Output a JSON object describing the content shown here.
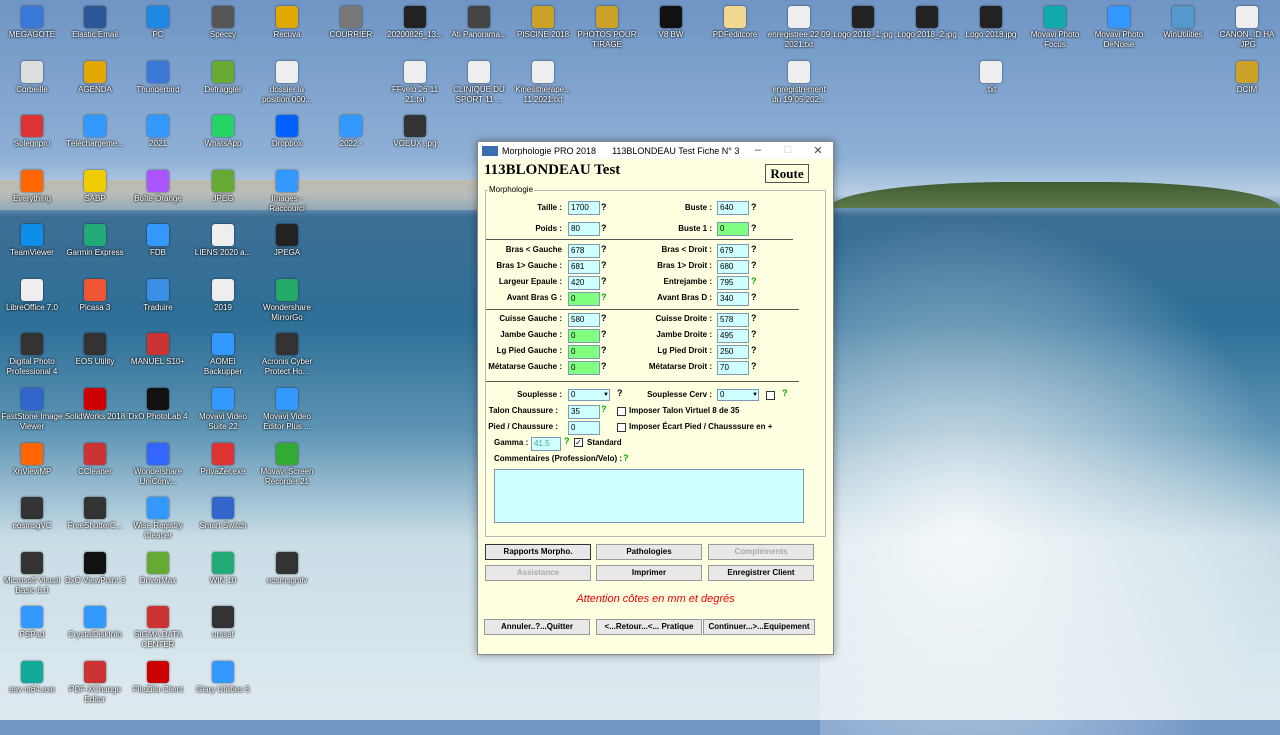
{
  "desktop_icons": [
    {
      "label": "MEGAGOTE",
      "color": "#3c78d8"
    },
    {
      "label": "Elastic Email",
      "color": "#2b5797"
    },
    {
      "label": "PC",
      "color": "#1e88e5"
    },
    {
      "label": "Speccy",
      "color": "#555"
    },
    {
      "label": "Recuva",
      "color": "#e0a800"
    },
    {
      "label": "COURRIER",
      "color": "#777"
    },
    {
      "label": "20200826_13...",
      "color": "#222"
    },
    {
      "label": "Ati Panorama...",
      "color": "#444"
    },
    {
      "label": "PISCINE 2018",
      "color": "#c9a227"
    },
    {
      "label": "PHOTOS POUR TIRAGE",
      "color": "#c9a227"
    },
    {
      "label": "V8 BW",
      "color": "#111"
    },
    {
      "label": "PDFeditcore",
      "color": "#f0d890"
    },
    {
      "label": "enregistree 22 09 2021.txt",
      "color": "#eee"
    },
    {
      "label": "Logo 2018_1.jpg",
      "color": "#222"
    },
    {
      "label": "Logo 2018_2.jpg",
      "color": "#222"
    },
    {
      "label": "Logo 2018.jpg",
      "color": "#222"
    },
    {
      "label": "Movavi Photo Focus",
      "color": "#1aa"
    },
    {
      "label": "Movavi Photo DeNoise",
      "color": "#39f"
    },
    {
      "label": "WinUtilities",
      "color": "#59c"
    },
    {
      "label": "CANON_ID HA .JPG",
      "color": "#eee"
    },
    {
      "label": "Corbeille",
      "color": "#ddd"
    },
    {
      "label": "AGENDA",
      "color": "#e0a800"
    },
    {
      "label": "Thunderbird",
      "color": "#3c78d8"
    },
    {
      "label": "Defraggler",
      "color": "#6a3"
    },
    {
      "label": "dossier la position 000...",
      "color": "#eee"
    },
    {
      "label": "FFvelo 26 11 21.txt",
      "color": "#eee"
    },
    {
      "label": "CLINIQUE DU SPORT 11 ...",
      "color": "#eee"
    },
    {
      "label": "Kinesitherape... 11 2021.txt",
      "color": "#eee"
    },
    {
      "label": "enregistrement du 19 05 202...",
      "color": "#eee"
    },
    {
      "label": ".txt",
      "color": "#eee"
    },
    {
      "label": "DCIM",
      "color": "#c9a227"
    },
    {
      "label": "Solegripro",
      "color": "#d33"
    },
    {
      "label": "Téléchargeme...",
      "color": "#39f"
    },
    {
      "label": "2021",
      "color": "#39f"
    },
    {
      "label": "WhatsApp",
      "color": "#25d366"
    },
    {
      "label": "Dropbox",
      "color": "#0061fe"
    },
    {
      "label": "2022 -",
      "color": "#39f"
    },
    {
      "label": "VOEUX .jpg",
      "color": "#333"
    },
    {
      "label": "Everything",
      "color": "#f60"
    },
    {
      "label": "SABP",
      "color": "#ec0"
    },
    {
      "label": "Boîte Orange",
      "color": "#a5f"
    },
    {
      "label": "JPEG",
      "color": "#6a3"
    },
    {
      "label": "Images - Raccourci",
      "color": "#39f"
    },
    {
      "label": "TeamViewer",
      "color": "#0e8ee9"
    },
    {
      "label": "Garmin Express",
      "color": "#2a7"
    },
    {
      "label": "FDB",
      "color": "#39f"
    },
    {
      "label": "LIENS 2020 a...",
      "color": "#eee"
    },
    {
      "label": "JPEGA",
      "color": "#222"
    },
    {
      "label": "LibreOffice 7.0",
      "color": "#eee"
    },
    {
      "label": "Picasa 3",
      "color": "#e53"
    },
    {
      "label": "Traduire",
      "color": "#3a8ee6"
    },
    {
      "label": "2019",
      "color": "#eee"
    },
    {
      "label": "Wondershare MirrorGo",
      "color": "#2a6"
    },
    {
      "label": "Digital Photo Professional 4",
      "color": "#333"
    },
    {
      "label": "EOS Utility",
      "color": "#333"
    },
    {
      "label": "MANUEL S10+",
      "color": "#c33"
    },
    {
      "label": "AOMEI Backupper",
      "color": "#39f"
    },
    {
      "label": "Acronis Cyber Protect Ho...",
      "color": "#333"
    },
    {
      "label": "FastStone Image Viewer",
      "color": "#36c"
    },
    {
      "label": "SolidWorks 2018",
      "color": "#c00"
    },
    {
      "label": "DxO PhotoLab 4",
      "color": "#111"
    },
    {
      "label": "Movavi Video Suite 22",
      "color": "#39f"
    },
    {
      "label": "Movavi Video Editor Plus ...",
      "color": "#39f"
    },
    {
      "label": "XnViewMP",
      "color": "#f60"
    },
    {
      "label": "CCleaner",
      "color": "#c33"
    },
    {
      "label": "Wondershare UniConv...",
      "color": "#36f"
    },
    {
      "label": "PrivaZer.exe",
      "color": "#d33"
    },
    {
      "label": "Movavi Screen Recorder 21",
      "color": "#3a3"
    },
    {
      "label": "eosmsgVC",
      "color": "#333"
    },
    {
      "label": "FreeShutterC...",
      "color": "#333"
    },
    {
      "label": "Wise Registry Cleaner",
      "color": "#39f"
    },
    {
      "label": "Smart Switch",
      "color": "#36c"
    },
    {
      "label": "Microsoft Visual Basic 6.0",
      "color": "#333"
    },
    {
      "label": "DxO ViewPoint 3",
      "color": "#111"
    },
    {
      "label": "DriverMax",
      "color": "#6a3"
    },
    {
      "label": "WIN 10",
      "color": "#2a7"
    },
    {
      "label": "eosmsgmlv",
      "color": "#333"
    },
    {
      "label": "PSPad",
      "color": "#39f"
    },
    {
      "label": "CrystalDiskInfo",
      "color": "#39f"
    },
    {
      "label": "SIGMA DATA CENTER",
      "color": "#c33"
    },
    {
      "label": "urssaf",
      "color": "#333"
    },
    {
      "label": "eav nt64.exe",
      "color": "#1a9"
    },
    {
      "label": "PDF-XChange Editor",
      "color": "#c33"
    },
    {
      "label": "FileZilla Client",
      "color": "#c00"
    },
    {
      "label": "Glary Utilities 5",
      "color": "#39f"
    }
  ],
  "window": {
    "app_title": "Morphologie PRO 2018",
    "fiche_title": "113BLONDEAU Test Fiche N° 3",
    "heading": "113BLONDEAU Test",
    "route_label": "Route",
    "group_label": "Morphologie",
    "controls": {
      "minimize": "–",
      "maximize": "□",
      "close": "✕"
    }
  },
  "fields": {
    "taille": {
      "label": "Taille :",
      "value": "1700"
    },
    "poids": {
      "label": "Poids :",
      "value": "80"
    },
    "buste": {
      "label": "Buste :",
      "value": "640"
    },
    "buste1": {
      "label": "Buste 1 :",
      "value": "0"
    },
    "bras_g": {
      "label": "Bras < Gauche",
      "value": "678"
    },
    "bras_d": {
      "label": "Bras < Droit :",
      "value": "679"
    },
    "bras1_g": {
      "label": "Bras 1> Gauche :",
      "value": "681"
    },
    "bras1_d": {
      "label": "Bras 1> Droit :",
      "value": "680"
    },
    "largeur_epaule": {
      "label": "Largeur Epaule :",
      "value": "420"
    },
    "entrejambe": {
      "label": "Entrejambe :",
      "value": "795"
    },
    "avant_bras_g": {
      "label": "Avant Bras G :",
      "value": "0"
    },
    "avant_bras_d": {
      "label": "Avant Bras D :",
      "value": "340"
    },
    "cuisse_g": {
      "label": "Cuisse Gauche :",
      "value": "580"
    },
    "cuisse_d": {
      "label": "Cuisse Droite :",
      "value": "578"
    },
    "jambe_g": {
      "label": "Jambe Gauche :",
      "value": "0"
    },
    "jambe_d": {
      "label": "Jambe Droite :",
      "value": "495"
    },
    "lg_pied_g": {
      "label": "Lg Pied Gauche :",
      "value": "0"
    },
    "lg_pied_d": {
      "label": "Lg Pied Droit :",
      "value": "250"
    },
    "metatarse_g": {
      "label": "Métatarse Gauche :",
      "value": "0"
    },
    "metatarse_d": {
      "label": "Métatarse Droit :",
      "value": "70"
    },
    "souplesse": {
      "label": "Souplesse :",
      "value": "0"
    },
    "souplesse_cerv": {
      "label": "Souplesse Cerv :",
      "value": "0"
    },
    "talon_chaussure": {
      "label": "Talon Chaussure :",
      "value": "35"
    },
    "pied_chaussure": {
      "label": "Pied / Chaussure :",
      "value": "0"
    },
    "gamma": {
      "label": "Gamma :",
      "value": "41.5"
    }
  },
  "checkboxes": {
    "imposer_talon": "Imposer Talon Virtuel 8 de 35",
    "imposer_ecart": "Imposer Écart Pied / Chausssure en +",
    "standard": "Standard"
  },
  "q": "?",
  "comment_label": "Commentaires (Profession/Velo) :",
  "buttons": {
    "rapports": "Rapports Morpho.",
    "pathologies": "Pathologies",
    "complements": "Compléments",
    "assistance": "Assistance",
    "imprimer": "Imprimer",
    "enregistrer": "Enregistrer Client",
    "annuler": "Annuler..?...Quitter",
    "retour": "<...Retour...<... Pratique",
    "continuer": "Continuer...>...Equipement"
  },
  "warning": "Attention côtes en mm et degrés"
}
